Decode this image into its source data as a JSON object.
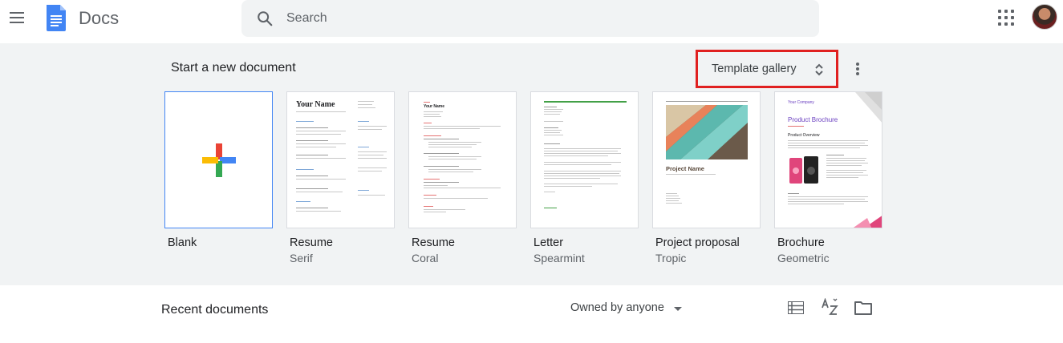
{
  "app": {
    "title": "Docs"
  },
  "search": {
    "placeholder": "Search",
    "icon": "search-icon"
  },
  "templates": {
    "section_title": "Start a new document",
    "gallery_label": "Template gallery",
    "items": [
      {
        "title": "Blank",
        "subtitle": ""
      },
      {
        "title": "Resume",
        "subtitle": "Serif",
        "preview_heading": "Your Name"
      },
      {
        "title": "Resume",
        "subtitle": "Coral",
        "preview_heading": "Your Name"
      },
      {
        "title": "Letter",
        "subtitle": "Spearmint"
      },
      {
        "title": "Project proposal",
        "subtitle": "Tropic",
        "preview_heading": "Project Name"
      },
      {
        "title": "Brochure",
        "subtitle": "Geometric",
        "preview_company": "Your Company",
        "preview_heading": "Product Brochure",
        "preview_section": "Product Overview"
      }
    ]
  },
  "recent": {
    "title": "Recent documents",
    "owner_filter": "Owned by anyone"
  },
  "colors": {
    "accent_blue": "#4285f4",
    "highlight_red": "#e02020",
    "section_bg": "#f1f3f4"
  }
}
